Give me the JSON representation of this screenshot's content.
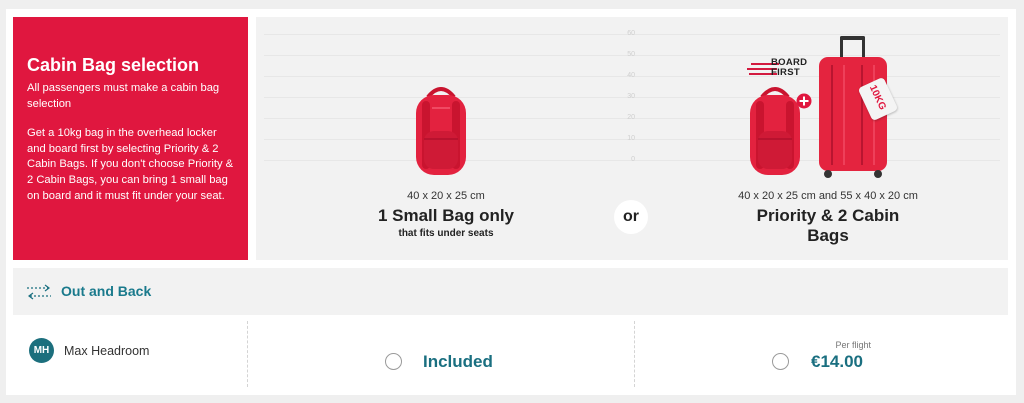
{
  "hero": {
    "title": "Cabin Bag selection",
    "line1": "All passengers must make a cabin bag selection",
    "line2": "Get a 10kg bag in the overhead locker and board first by selecting Priority & 2 Cabin Bags. If you don't choose Priority & 2 Cabin Bags, you can bring 1 small bag on board and it must fit under your seat."
  },
  "options": {
    "tick_labels": [
      "60",
      "50",
      "40",
      "30",
      "20",
      "10",
      "0"
    ],
    "small_bag": {
      "dimensions": "40 x 20 x 25 cm",
      "title": "1 Small Bag only",
      "subtitle": "that fits under seats"
    },
    "or_label": "or",
    "priority": {
      "badge_line1": "BOARD",
      "badge_line2": "FIRST",
      "tag_label": "10KG",
      "dimensions": "40 x 20 x 25 cm and 55 x 40 x 20 cm",
      "title": "Priority & 2 Cabin Bags"
    }
  },
  "route": {
    "label": "Out and Back",
    "icon": "return-arrows-icon"
  },
  "passenger": {
    "initials": "MH",
    "name": "Max Headroom",
    "small_bag_price": "Included",
    "per_flight_label": "Per flight",
    "priority_price": "€14.00"
  },
  "colors": {
    "brand_red": "#e0173f",
    "teal": "#1a6f80",
    "avatar_teal": "#1c6f7d"
  }
}
